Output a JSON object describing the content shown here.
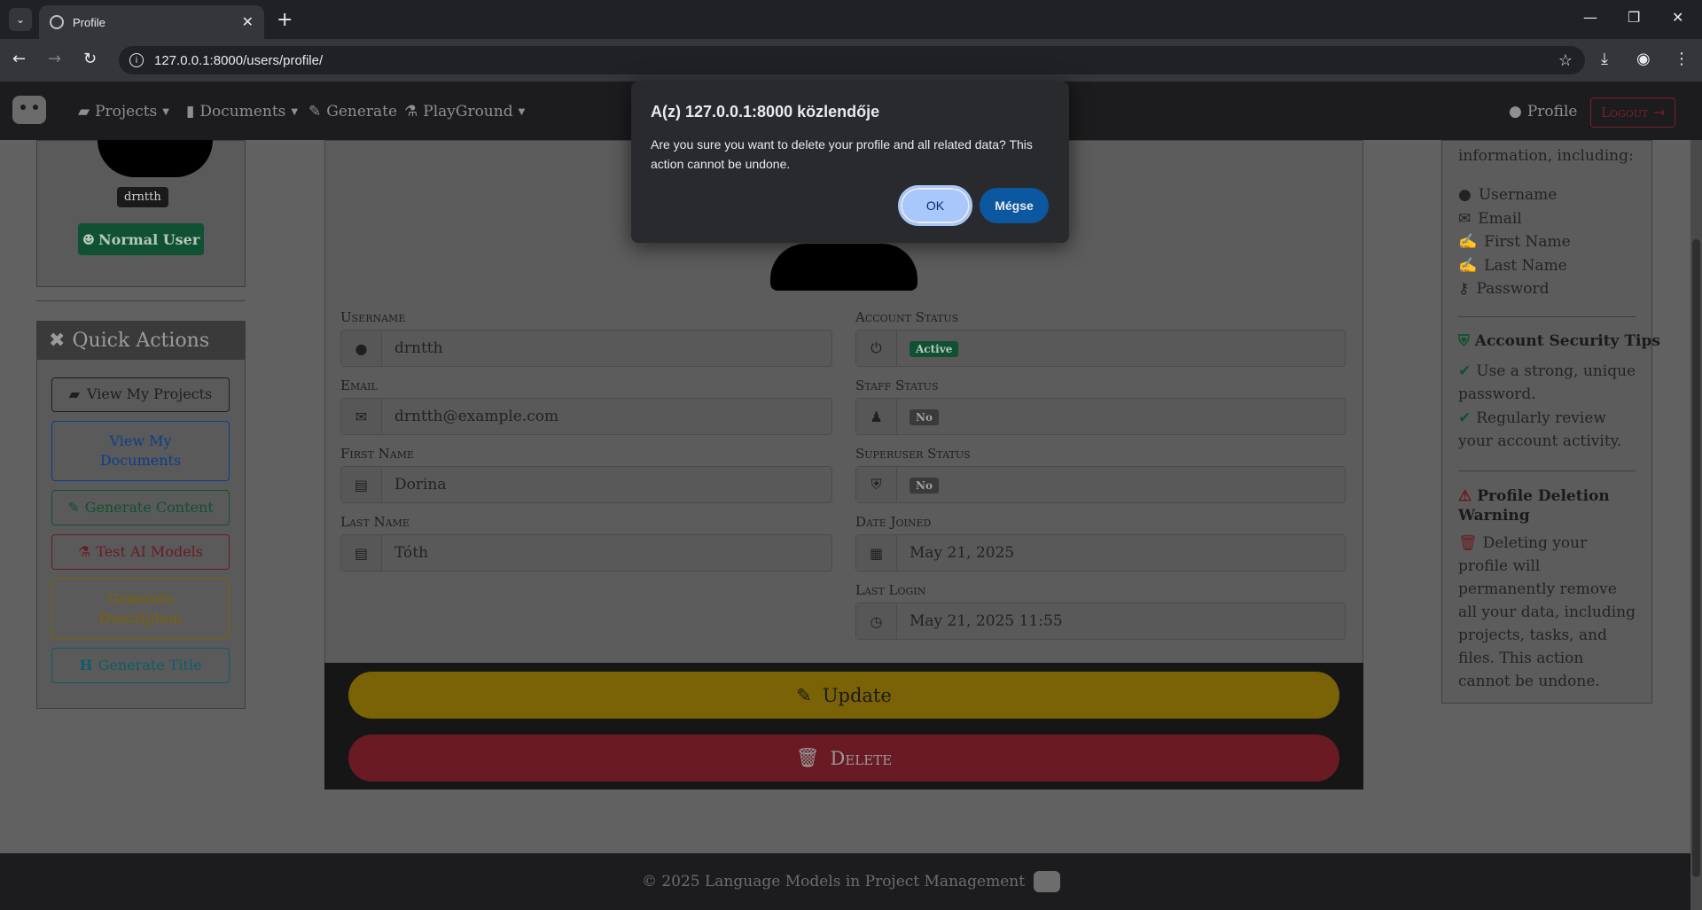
{
  "browser": {
    "tab_title": "Profile",
    "url": "127.0.0.1:8000/users/profile/",
    "new_tab": "+",
    "tab_close": "✕"
  },
  "navbar": {
    "items": [
      {
        "label": "Projects",
        "icon": "folder-icon"
      },
      {
        "label": "Documents",
        "icon": "file-icon"
      },
      {
        "label": "Generate",
        "icon": "pen-icon"
      },
      {
        "label": "PlayGround",
        "icon": "flask-icon"
      }
    ],
    "profile_label": "Profile",
    "logout_label": "Logout"
  },
  "left_sidebar": {
    "username_badge": "drntth",
    "role_badge": "Normal User",
    "quick_actions_title": "Quick Actions",
    "actions": [
      {
        "label": "View My Projects",
        "color": "#1f1f1f"
      },
      {
        "label": "View My Documents",
        "color": "#0b3e8a"
      },
      {
        "label": "Generate Content",
        "color": "#0f5132"
      },
      {
        "label": "Test AI Models",
        "color": "#6a1a22"
      },
      {
        "label": "Generate Description",
        "color": "#7a6206"
      },
      {
        "label": "Generate Title",
        "color": "#0b5e6a"
      }
    ]
  },
  "profile": {
    "username_label": "Username",
    "username_value": "drntth",
    "email_label": "Email",
    "email_value": "drntth@example.com",
    "first_name_label": "First Name",
    "first_name_value": "Dorina",
    "last_name_label": "Last Name",
    "last_name_value": "Tóth",
    "account_status_label": "Account Status",
    "account_status_value": "Active",
    "staff_status_label": "Staff Status",
    "staff_status_value": "No",
    "superuser_status_label": "Superuser Status",
    "superuser_status_value": "No",
    "date_joined_label": "Date Joined",
    "date_joined_value": "May 21, 2025",
    "last_login_label": "Last Login",
    "last_login_value": "May 21, 2025 11:55",
    "update_label": "Update",
    "delete_label": "Delete"
  },
  "right_sidebar": {
    "intro": "information, including:",
    "fields": [
      "Username",
      "Email",
      "First Name",
      "Last Name",
      "Password"
    ],
    "security_title": "Account Security Tips",
    "tip1": "Use a strong, unique password.",
    "tip2": "Regularly review your account activity.",
    "warning_title": "Profile Deletion Warning",
    "warning_text": "Deleting your profile will permanently remove all your data, including projects, tasks, and files. This action cannot be undone."
  },
  "footer": {
    "text": "© 2025 Language Models in Project Management"
  },
  "dialog": {
    "title": "A(z) 127.0.0.1:8000 közlendője",
    "message": "Are you sure you want to delete your profile and all related data? This action cannot be undone.",
    "ok_label": "OK",
    "cancel_label": "Mégse"
  }
}
